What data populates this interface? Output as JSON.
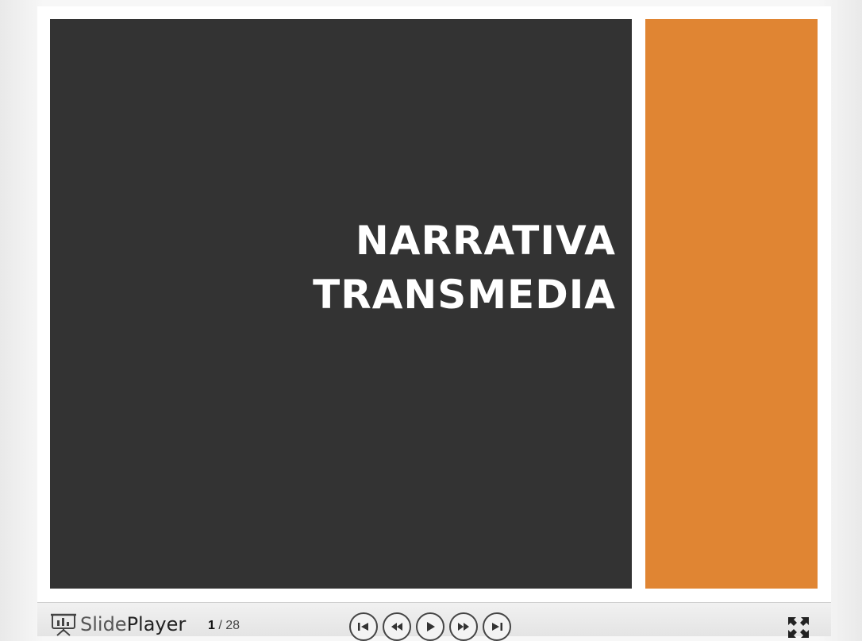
{
  "slide": {
    "title_line1": "NARRATIVA",
    "title_line2": "TRANSMEDIA",
    "colors": {
      "dark_panel": "#333333",
      "accent_panel": "#e08533"
    }
  },
  "player": {
    "brand_part1": "Slide",
    "brand_part2": "Player",
    "current_page": "1",
    "separator": " / ",
    "total_pages": "28",
    "controls": [
      "first-slide-icon",
      "previous-slide-icon",
      "play-icon",
      "next-slide-icon",
      "last-slide-icon"
    ],
    "fullscreen_icon": "fullscreen-icon"
  }
}
